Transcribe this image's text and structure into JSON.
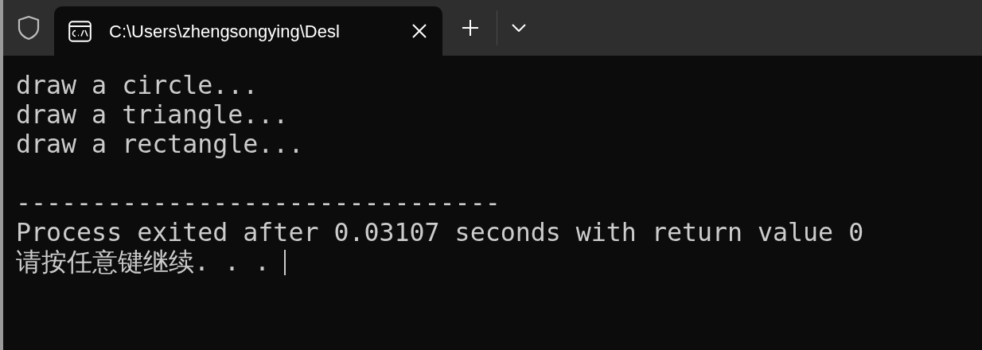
{
  "tab": {
    "title": "C:\\Users\\zhengsongying\\Desl",
    "selected": true
  },
  "console": {
    "lines": [
      {
        "kind": "text",
        "text": "draw a circle..."
      },
      {
        "kind": "text",
        "text": "draw a triangle..."
      },
      {
        "kind": "text",
        "text": "draw a rectangle..."
      },
      {
        "kind": "gap"
      },
      {
        "kind": "text",
        "text": "--------------------------------"
      },
      {
        "kind": "text",
        "text": "Process exited after 0.03107 seconds with return value 0"
      },
      {
        "kind": "prompt",
        "text": "请按任意键继续. . ."
      }
    ]
  }
}
